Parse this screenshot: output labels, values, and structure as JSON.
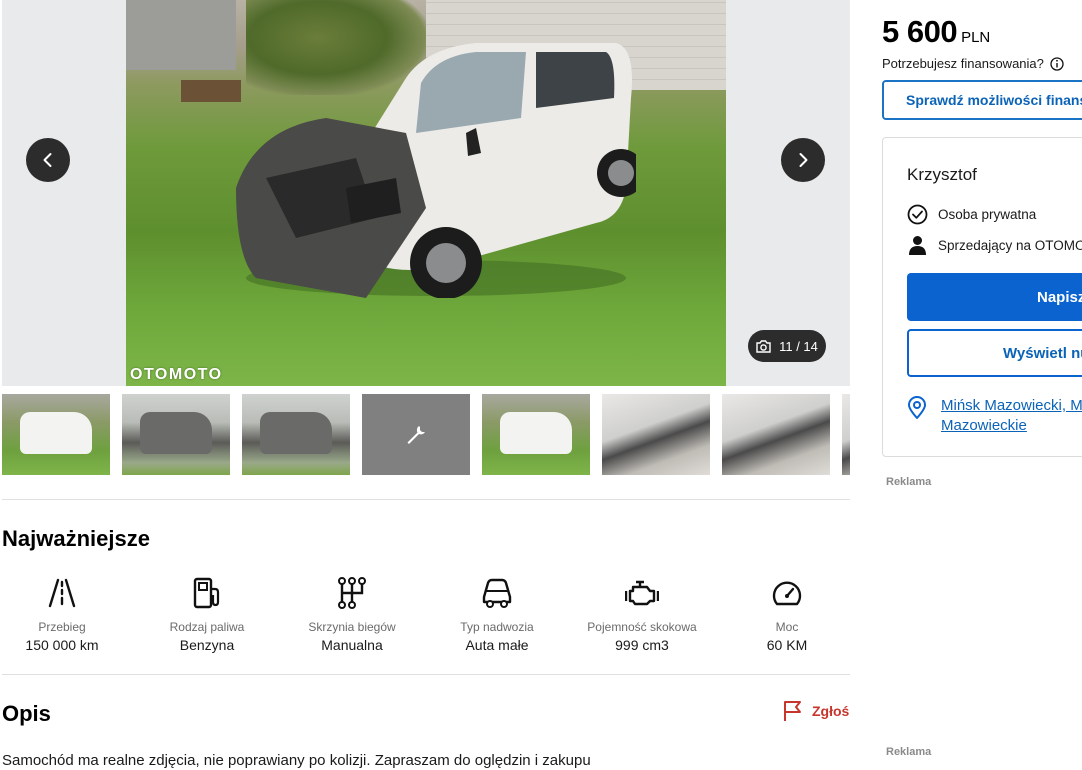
{
  "gallery": {
    "counter": "11 / 14",
    "watermark": "OTOMOTO",
    "thumbnails": [
      "photo-1",
      "photo-2",
      "photo-3",
      "service-history",
      "photo-5",
      "photo-6",
      "photo-7",
      "photo-8"
    ]
  },
  "specs": {
    "title": "Najważniejsze",
    "items": [
      {
        "icon": "road-icon",
        "label": "Przebieg",
        "value": "150 000 km"
      },
      {
        "icon": "fuel-pump-icon",
        "label": "Rodzaj paliwa",
        "value": "Benzyna"
      },
      {
        "icon": "gearbox-icon",
        "label": "Skrzynia biegów",
        "value": "Manualna"
      },
      {
        "icon": "car-body-icon",
        "label": "Typ nadwozia",
        "value": "Auta małe"
      },
      {
        "icon": "engine-icon",
        "label": "Pojemność skokowa",
        "value": "999 cm3"
      },
      {
        "icon": "speedometer-icon",
        "label": "Moc",
        "value": "60 KM"
      }
    ]
  },
  "description": {
    "title": "Opis",
    "report_label": "Zgłoś",
    "text": "Samochód ma realne zdjęcia, nie poprawiany po kolizji. Zapraszam do oględzin i zakupu"
  },
  "price": {
    "amount": "5 600",
    "currency": "PLN",
    "finance_question": "Potrzebujesz finansowania?",
    "finance_button": "Sprawdź możliwości finansowania"
  },
  "seller": {
    "name": "Krzysztof",
    "type": "Osoba prywatna",
    "platform": "Sprzedający na OTOMOTO od",
    "write_button": "Napisz",
    "show_button": "Wyświetl numer",
    "location_line1": "Mińsk Mazowiecki, Mińsk",
    "location_line2": "Mazowieckie"
  },
  "ads": {
    "label_1": "Reklama",
    "label_2": "Reklama"
  },
  "colors": {
    "accent": "#0b63cf",
    "report": "#c6362c"
  }
}
